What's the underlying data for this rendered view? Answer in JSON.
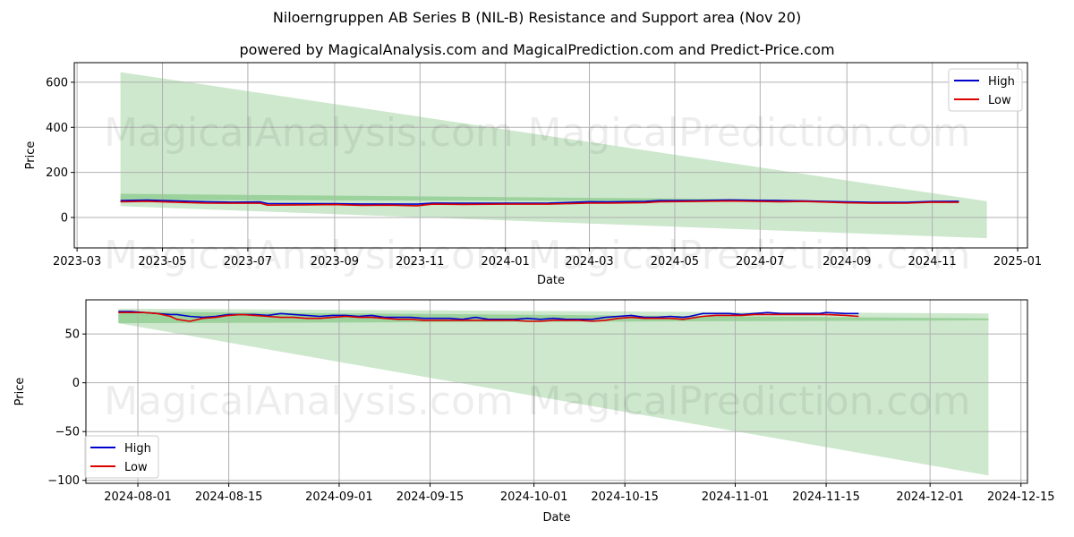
{
  "title": "Niloerngruppen AB Series B (NIL-B) Resistance and Support area (Nov 20)",
  "subtitle": "powered by MagicalAnalysis.com and MagicalPrediction.com and Predict-Price.com",
  "watermarks": [
    "MagicalAnalysis.com",
    "MagicalPrediction.com"
  ],
  "colors": {
    "high": "#0000cc",
    "low": "#dd0000",
    "band": "#2ca02c"
  },
  "chart_data": [
    {
      "type": "line",
      "name": "full-history",
      "xlabel": "Date",
      "ylabel": "Price",
      "ylim": [
        -135,
        687
      ],
      "xlim": [
        "2023-02-27",
        "2025-01-08"
      ],
      "grid": true,
      "legend": {
        "position": "top-right",
        "entries": [
          "High",
          "Low"
        ]
      },
      "yticks": [
        0,
        200,
        400,
        600
      ],
      "xticks": [
        "2023-03-01",
        "2023-05-01",
        "2023-07-01",
        "2023-09-01",
        "2023-11-01",
        "2024-01-01",
        "2024-03-01",
        "2024-05-01",
        "2024-07-01",
        "2024-09-01",
        "2024-11-01",
        "2025-01-01"
      ],
      "xtick_labels": [
        "2023-03",
        "2023-05",
        "2023-07",
        "2023-09",
        "2023-11",
        "2024-01",
        "2024-03",
        "2024-05",
        "2024-07",
        "2024-09",
        "2024-11",
        "2025-01"
      ],
      "bands": [
        {
          "name": "wide-resistance-support",
          "x": [
            "2023-04-01",
            "2024-12-10"
          ],
          "upper": [
            645,
            72
          ],
          "lower": [
            50,
            -92
          ]
        },
        {
          "name": "narrow-resistance",
          "x": [
            "2023-04-01",
            "2024-07-15"
          ],
          "upper": [
            105,
            80
          ],
          "lower": [
            78,
            72
          ]
        }
      ],
      "x": [
        "2023-04-01",
        "2023-04-20",
        "2023-05-10",
        "2023-06-01",
        "2023-06-20",
        "2023-07-10",
        "2023-07-15",
        "2023-08-10",
        "2023-09-01",
        "2023-09-20",
        "2023-10-10",
        "2023-10-30",
        "2023-11-10",
        "2023-12-01",
        "2024-01-01",
        "2024-02-01",
        "2024-03-01",
        "2024-03-15",
        "2024-04-10",
        "2024-04-20",
        "2024-05-15",
        "2024-06-10",
        "2024-07-01",
        "2024-07-15",
        "2024-08-01",
        "2024-09-01",
        "2024-09-20",
        "2024-10-15",
        "2024-11-01",
        "2024-11-20"
      ],
      "series": [
        {
          "name": "High",
          "values": [
            75,
            77,
            74,
            70,
            68,
            69,
            62,
            61,
            61,
            60,
            60,
            59,
            64,
            63,
            63,
            64,
            70,
            69,
            71,
            75,
            75,
            78,
            76,
            75,
            74,
            69,
            67,
            68,
            71,
            72
          ]
        },
        {
          "name": "Low",
          "values": [
            70,
            72,
            68,
            64,
            63,
            63,
            55,
            56,
            57,
            54,
            55,
            52,
            59,
            58,
            59,
            59,
            64,
            64,
            66,
            70,
            71,
            73,
            71,
            70,
            71,
            65,
            63,
            64,
            68,
            67
          ]
        }
      ]
    },
    {
      "type": "line",
      "name": "recent-zoom",
      "xlabel": "Date",
      "ylabel": "Price",
      "ylim": [
        -103,
        85
      ],
      "xlim": [
        "2024-07-24",
        "2024-12-16"
      ],
      "grid": true,
      "legend": {
        "position": "bottom-left",
        "entries": [
          "High",
          "Low"
        ]
      },
      "yticks": [
        -100,
        -50,
        0,
        50
      ],
      "xticks": [
        "2024-08-01",
        "2024-08-15",
        "2024-09-01",
        "2024-09-15",
        "2024-10-01",
        "2024-10-15",
        "2024-11-01",
        "2024-11-15",
        "2024-12-01",
        "2024-12-15"
      ],
      "bands": [
        {
          "name": "wide-resistance-support",
          "x": [
            "2024-07-29",
            "2024-12-10"
          ],
          "upper": [
            76,
            71
          ],
          "lower": [
            61,
            -95
          ]
        },
        {
          "name": "narrow-resistance",
          "x": [
            "2024-07-29",
            "2024-12-10"
          ],
          "upper": [
            73,
            66
          ],
          "lower": [
            61,
            64
          ]
        }
      ],
      "x": [
        "2024-07-29",
        "2024-07-31",
        "2024-08-02",
        "2024-08-04",
        "2024-08-06",
        "2024-08-07",
        "2024-08-09",
        "2024-08-11",
        "2024-08-13",
        "2024-08-15",
        "2024-08-17",
        "2024-08-19",
        "2024-08-21",
        "2024-08-23",
        "2024-08-25",
        "2024-08-27",
        "2024-08-29",
        "2024-08-31",
        "2024-09-02",
        "2024-09-04",
        "2024-09-06",
        "2024-09-08",
        "2024-09-10",
        "2024-09-12",
        "2024-09-14",
        "2024-09-16",
        "2024-09-18",
        "2024-09-20",
        "2024-09-22",
        "2024-09-24",
        "2024-09-26",
        "2024-09-28",
        "2024-09-30",
        "2024-10-02",
        "2024-10-04",
        "2024-10-06",
        "2024-10-08",
        "2024-10-10",
        "2024-10-12",
        "2024-10-14",
        "2024-10-16",
        "2024-10-18",
        "2024-10-20",
        "2024-10-22",
        "2024-10-24",
        "2024-10-25",
        "2024-10-27",
        "2024-10-29",
        "2024-10-31",
        "2024-11-02",
        "2024-11-04",
        "2024-11-06",
        "2024-11-08",
        "2024-11-10",
        "2024-11-12",
        "2024-11-14",
        "2024-11-15",
        "2024-11-18",
        "2024-11-20"
      ],
      "series": [
        {
          "name": "High",
          "values": [
            73,
            73,
            72,
            71,
            70,
            70,
            68,
            67,
            68,
            70,
            70,
            70,
            69,
            71,
            70,
            69,
            68,
            69,
            69,
            68,
            69,
            67,
            67,
            67,
            66,
            66,
            66,
            65,
            67,
            65,
            65,
            65,
            66,
            65,
            66,
            65,
            65,
            65,
            67,
            68,
            69,
            67,
            67,
            68,
            67,
            68,
            71,
            71,
            71,
            70,
            71,
            72,
            71,
            71,
            71,
            71,
            72,
            71,
            71
          ]
        },
        {
          "name": "Low",
          "values": [
            72,
            72,
            72,
            71,
            68,
            65,
            63,
            66,
            67,
            69,
            70,
            69,
            68,
            67,
            67,
            66,
            66,
            67,
            68,
            67,
            67,
            66,
            65,
            65,
            64,
            64,
            64,
            64,
            64,
            64,
            64,
            64,
            63,
            63,
            64,
            64,
            64,
            63,
            64,
            66,
            67,
            66,
            66,
            66,
            65,
            66,
            68,
            69,
            69,
            69,
            70,
            70,
            70,
            70,
            70,
            70,
            70,
            69,
            68
          ]
        }
      ]
    }
  ]
}
